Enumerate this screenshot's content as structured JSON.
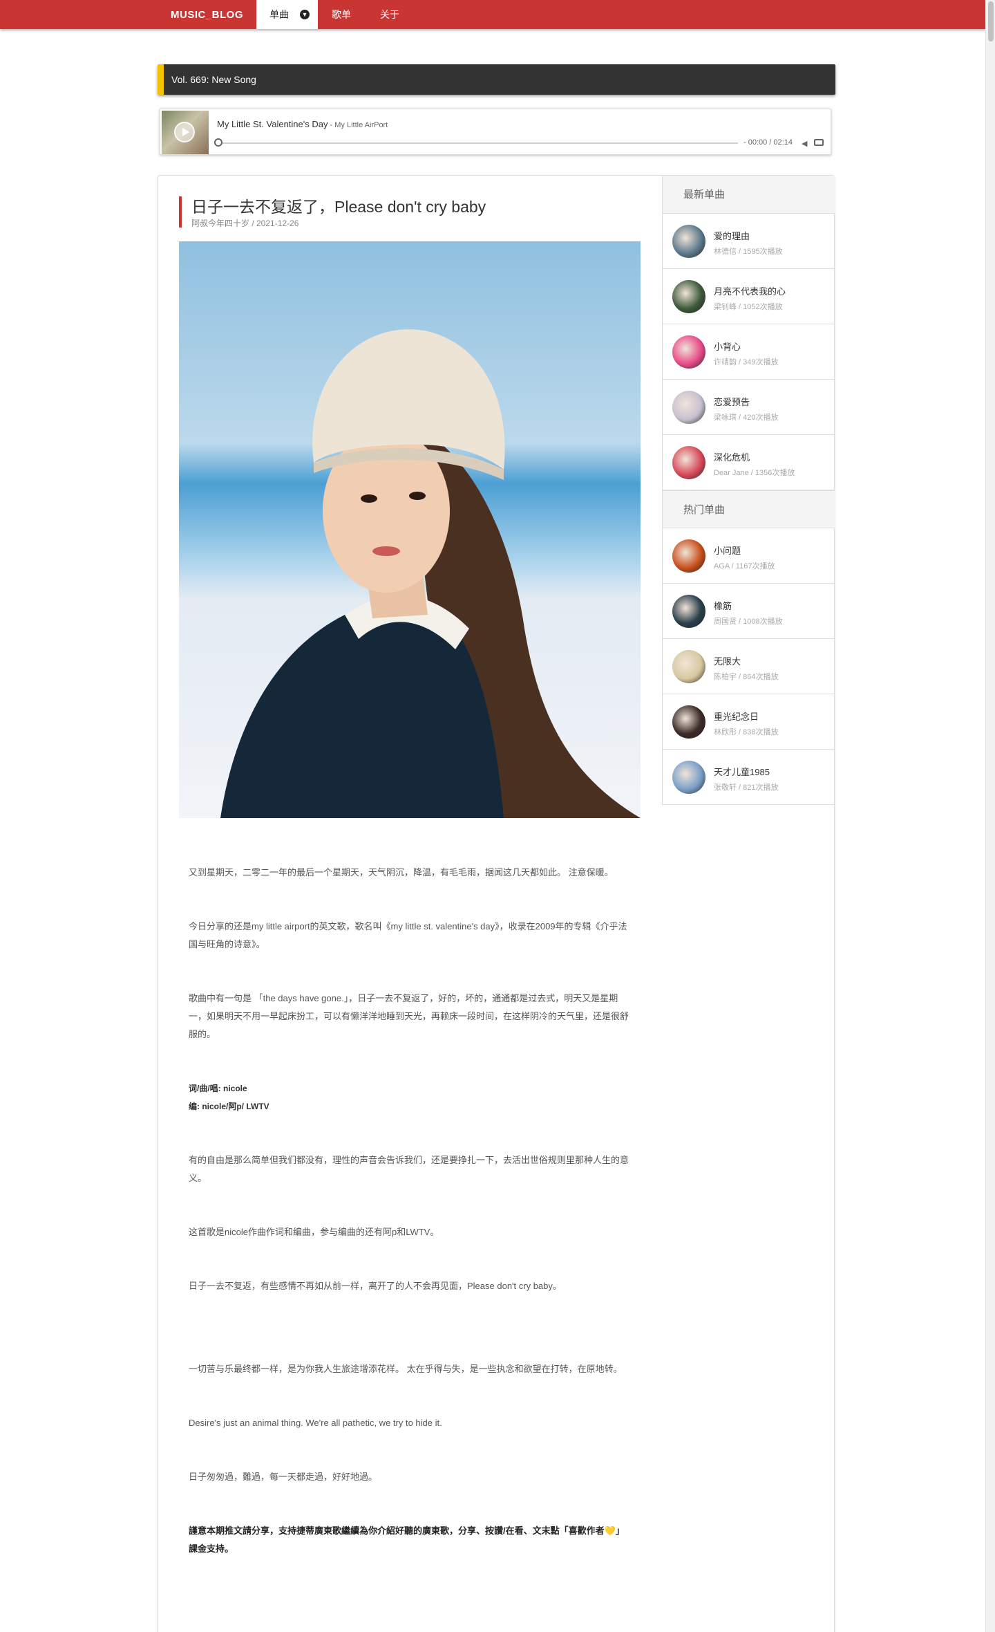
{
  "nav": {
    "brand": "MUSIC_BLOG",
    "tabs": [
      {
        "label": "单曲",
        "active": true
      },
      {
        "label": "歌单"
      },
      {
        "label": "关于"
      }
    ]
  },
  "volume_header": "Vol. 669: New Song",
  "player": {
    "title": "My Little St. Valentine's Day",
    "artist": " - My Little AirPort",
    "time": "- 00:00 / 02:14"
  },
  "post": {
    "title": "日子一去不复返了，Please don't cry baby",
    "meta": "阿叔今年四十岁 / 2021-12-26",
    "paragraphs": [
      "又到星期天，二零二一年的最后一个星期天，天气阴沉，降温，有毛毛雨，据闻这几天都如此。 注意保暖。",
      "今日分享的还是my little airport的英文歌，歌名叫《my little st. valentine's day》，收录在2009年的专辑《介乎法国与旺角的诗意》。",
      "歌曲中有一句是 「the days have gone.」，日子一去不复返了，好的，坏的，通通都是过去式，明天又是星期一，如果明天不用一早起床扮工，可以有懒洋洋地睡到天光，再赖床一段时间，在这样阴冷的天气里，还是很舒服的。",
      "词/曲/唱: nicole\n编: nicole/阿p/ LWTV",
      "有的自由是那么简单但我们都没有，理性的声音会告诉我们，还是要挣扎一下，去活出世俗规则里那种人生的意义。",
      "这首歌是nicole作曲作词和编曲，参与编曲的还有阿p和LWTV。",
      "日子一去不复返，有些感情不再如从前一样，离开了的人不会再见面，Please don't cry baby。",
      "一切苦与乐最终都一样，是为你我人生旅途增添花样。 太在乎得与失，是一些执念和欲望在打转，在原地转。",
      "Desire's just an animal thing. We're all pathetic, we try to hide it.",
      "日子匆匆過，難過，每一天都走過，好好地過。",
      "謹意本期推文請分享，支持捷蒂廣東歌繼續為你介紹好聽的廣東歌，分享、按讚/在看、文末點「喜歡作者💛」課金支持。"
    ]
  },
  "sidebar": {
    "latest_title": "最新单曲",
    "latest": [
      {
        "name": "爱的理由",
        "meta": "林德信 / 1595次播放",
        "color": "#5d7a8c"
      },
      {
        "name": "月亮不代表我的心",
        "meta": "梁钊峰 / 1052次播放",
        "color": "#3d5a3a"
      },
      {
        "name": "小背心",
        "meta": "许靖韵 / 349次播放",
        "color": "#e84a8a"
      },
      {
        "name": "恋爱预告",
        "meta": "梁咏琪 / 420次播放",
        "color": "#c8c0d0"
      },
      {
        "name": "深化危机",
        "meta": "Dear Jane / 1356次播放",
        "color": "#d84a5a"
      }
    ],
    "hot_title": "热门单曲",
    "hot": [
      {
        "name": "小问题",
        "meta": "AGA / 1167次播放",
        "color": "#c8501c"
      },
      {
        "name": "橡筋",
        "meta": "周国贤 / 1008次播放",
        "color": "#2a3f4a"
      },
      {
        "name": "无限大",
        "meta": "陈柏宇 / 864次播放",
        "color": "#d8c8a0"
      },
      {
        "name": "重光纪念日",
        "meta": "林欣彤 / 838次播放",
        "color": "#3a2a28"
      },
      {
        "name": "天才儿童1985",
        "meta": "张敬轩 / 821次播放",
        "color": "#7aa0c8"
      }
    ]
  }
}
